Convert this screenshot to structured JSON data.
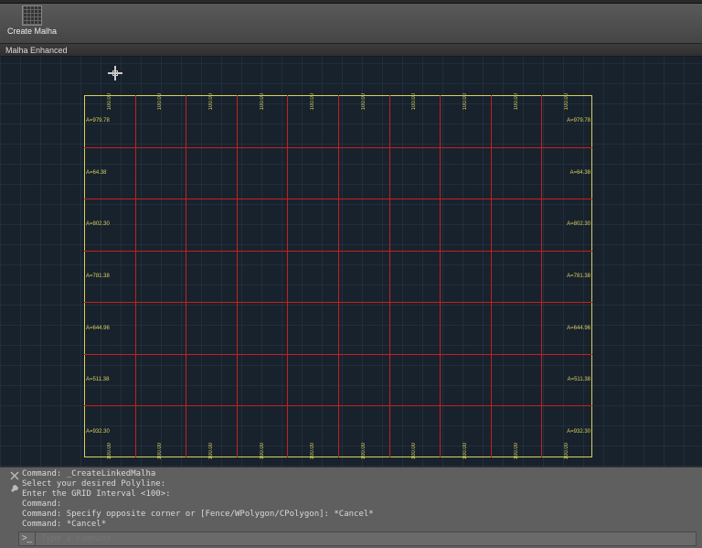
{
  "ribbon": {
    "button_label": "Create Malha",
    "panel_name": "Malha Enhanced"
  },
  "grid": {
    "cols": 10,
    "rows": 7,
    "h_dim": "100.00",
    "v_dim_prefix": "A=",
    "v_labels": [
      "979.78",
      "64.38",
      "802.30",
      "781.38",
      "644.96",
      "511.38",
      "932.30"
    ]
  },
  "command": {
    "history": [
      "Command: _CreateLinkedMalha",
      "Select your desired Polyline:",
      "Enter the GRID Interval <100>:",
      "Command:",
      "Command: Specify opposite corner or [Fence/WPolygon/CPolygon]: *Cancel*",
      "Command: *Cancel*"
    ],
    "placeholder": "Type a command",
    "prompt": ">_"
  }
}
